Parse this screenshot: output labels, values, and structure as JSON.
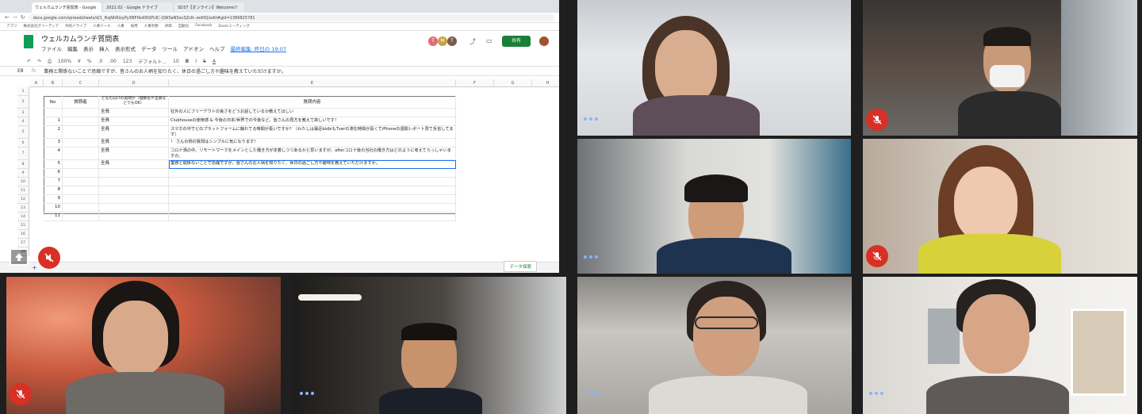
{
  "browser": {
    "tabs": [
      "ウェルカムランチ質問表 - Google",
      "2021.02 - Google ドライブ",
      "SD37【オンライン】Welcome!!"
    ],
    "url": "docs.google.com/spreadsheets/d/1_fkqNhRIzyPy3NFfdsKRSPUIC-QWSeN5ecSZcR--zeKfQ/edit#gid=1389825781"
  },
  "bookmarks": [
    "アプリ",
    "株式会社グリーディア",
    "共有ドライブ",
    "人事ツール",
    "人事",
    "採用",
    "人事労務",
    "評価",
    "自動化",
    "Facebook",
    "Zoomミーティング"
  ],
  "sheet": {
    "title": "ウェルカムランチ質問表",
    "menus": [
      "ファイル",
      "編集",
      "表示",
      "挿入",
      "表示形式",
      "データ",
      "ツール",
      "アドオン",
      "ヘルプ"
    ],
    "last_edit": "最終編集: 昨日の 19:07",
    "share_label": "共有",
    "toolbar": [
      "100%",
      "¥",
      "%",
      ".0",
      ".00",
      "123",
      "デフォルト...",
      "10",
      "B",
      "I",
      "S",
      "A"
    ],
    "cell_ref": "E8",
    "formula": "業務と関係ないことで恐縮ですが、皆さんのお人柄を知りたく、休日の過ごし方や趣味を教えていただけますか。",
    "col_headers": [
      "A",
      "B",
      "C",
      "D",
      "E",
      "F",
      "G",
      "H"
    ],
    "row_numbers": [
      "1",
      "2",
      "3",
      "4",
      "5",
      "6",
      "7",
      "8",
      "9",
      "10",
      "11",
      "12",
      "13",
      "14",
      "15",
      "16",
      "17",
      "18"
    ],
    "header": {
      "no": "No",
      "asker": "質問者",
      "target": "どなた向けの質問か（個数名や全員などでもOK）",
      "content": "質問内容"
    },
    "rows": [
      {
        "no": "",
        "target": "全員",
        "content": "社外の人にフリーアウトの良さをどうお話しているか教えてほしい"
      },
      {
        "no": "1",
        "target": "全員",
        "content": "Clubhouseの使用感 & 今後の日本/世界での今後など、皆さんの見方を教えて欲しいです！"
      },
      {
        "no": "2",
        "target": "全員",
        "content": "スマホの中でどのプラットフォームに触れてる時間が長いですか？（わたしは最近bizbiもTverの滞在時間が長くてiPhoneの週間レポート見て反省してます）"
      },
      {
        "no": "3",
        "target": "全員",
        "content": "！ さんの例の質問はシンプルに気になります！"
      },
      {
        "no": "4",
        "target": "全員",
        "content": "コロナ渦の中、リモートワークをメインとした働き方が定着しつつあるかと思いますが、afterコロナ後の当社の働き方はどのように考えてらっしゃいますか。"
      },
      {
        "no": "5",
        "target": "全員",
        "content": "業務と関係ないことで恐縮ですが、皆さんのお人柄を知りたく、休日の過ごし方や趣味を教えていただけますか。"
      },
      {
        "no": "6",
        "target": "",
        "content": ""
      },
      {
        "no": "7",
        "target": "",
        "content": ""
      },
      {
        "no": "8",
        "target": "",
        "content": ""
      },
      {
        "no": "9",
        "target": "",
        "content": ""
      },
      {
        "no": "10",
        "target": "",
        "content": ""
      },
      {
        "no": "11",
        "target": "",
        "content": ""
      }
    ],
    "explore_label": "データ探索",
    "avatars": [
      "T",
      "M",
      "T"
    ]
  },
  "colors": {
    "mute": "#d93025",
    "sheets_green": "#0f9d58",
    "share_green": "#188038",
    "speaking": "#8ab4f8"
  },
  "participants": [
    {
      "id": "p1",
      "muted": false
    },
    {
      "id": "p2",
      "muted": true
    },
    {
      "id": "p3",
      "muted": false
    },
    {
      "id": "p4",
      "muted": true
    },
    {
      "id": "p5",
      "muted": true
    },
    {
      "id": "p6",
      "muted": false
    },
    {
      "id": "p7",
      "muted": false
    },
    {
      "id": "p8",
      "muted": false
    }
  ]
}
